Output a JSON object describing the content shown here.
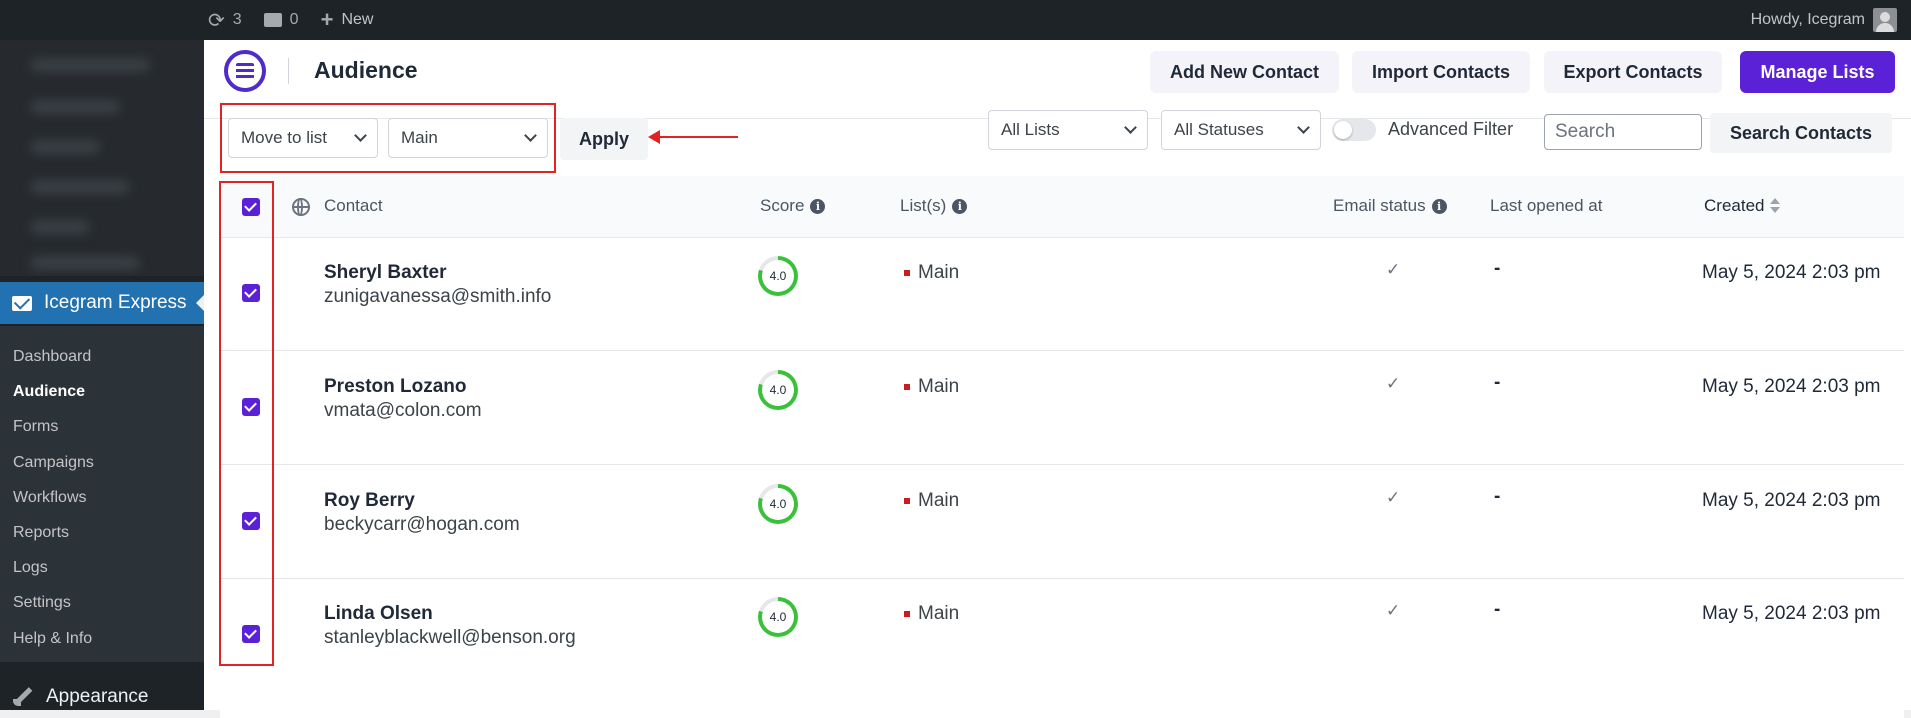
{
  "admin_bar": {
    "updates_count": "3",
    "comments_count": "0",
    "new_label": "New",
    "howdy": "Howdy, Icegram"
  },
  "sidebar": {
    "active_plugin": "Icegram Express",
    "submenu": [
      "Dashboard",
      "Audience",
      "Forms",
      "Campaigns",
      "Workflows",
      "Reports",
      "Logs",
      "Settings",
      "Help & Info"
    ],
    "current": "Audience",
    "next_menu": "Appearance"
  },
  "header": {
    "title": "Audience",
    "buttons": {
      "add_contact": "Add New Contact",
      "import": "Import Contacts",
      "export": "Export Contacts",
      "manage_lists": "Manage Lists"
    }
  },
  "toolbar": {
    "bulk_action": "Move to list",
    "target_list": "Main",
    "apply": "Apply",
    "lists_filter": "All Lists",
    "status_filter": "All Statuses",
    "advanced_filter": "Advanced Filter",
    "search_placeholder": "Search",
    "search_button": "Search Contacts"
  },
  "table": {
    "columns": {
      "contact": "Contact",
      "score": "Score",
      "lists": "List(s)",
      "email_status": "Email status",
      "last_opened": "Last opened at",
      "created": "Created"
    },
    "rows": [
      {
        "name": "Sheryl Baxter",
        "email": "zunigavanessa@smith.info",
        "score": "4.0",
        "list": "Main",
        "email_status": "✓",
        "last_opened": "-",
        "created": "May 5, 2024 2:03 pm"
      },
      {
        "name": "Preston Lozano",
        "email": "vmata@colon.com",
        "score": "4.0",
        "list": "Main",
        "email_status": "✓",
        "last_opened": "-",
        "created": "May 5, 2024 2:03 pm"
      },
      {
        "name": "Roy Berry",
        "email": "beckycarr@hogan.com",
        "score": "4.0",
        "list": "Main",
        "email_status": "✓",
        "last_opened": "-",
        "created": "May 5, 2024 2:03 pm"
      },
      {
        "name": "Linda Olsen",
        "email": "stanleyblackwell@benson.org",
        "score": "4.0",
        "list": "Main",
        "email_status": "✓",
        "last_opened": "-",
        "created": "May 5, 2024 2:03 pm"
      }
    ]
  },
  "colors": {
    "brand": "#5b21d6",
    "wp_blue": "#2271b1",
    "highlight_red": "#e02424",
    "score_green": "#3ac13a"
  }
}
